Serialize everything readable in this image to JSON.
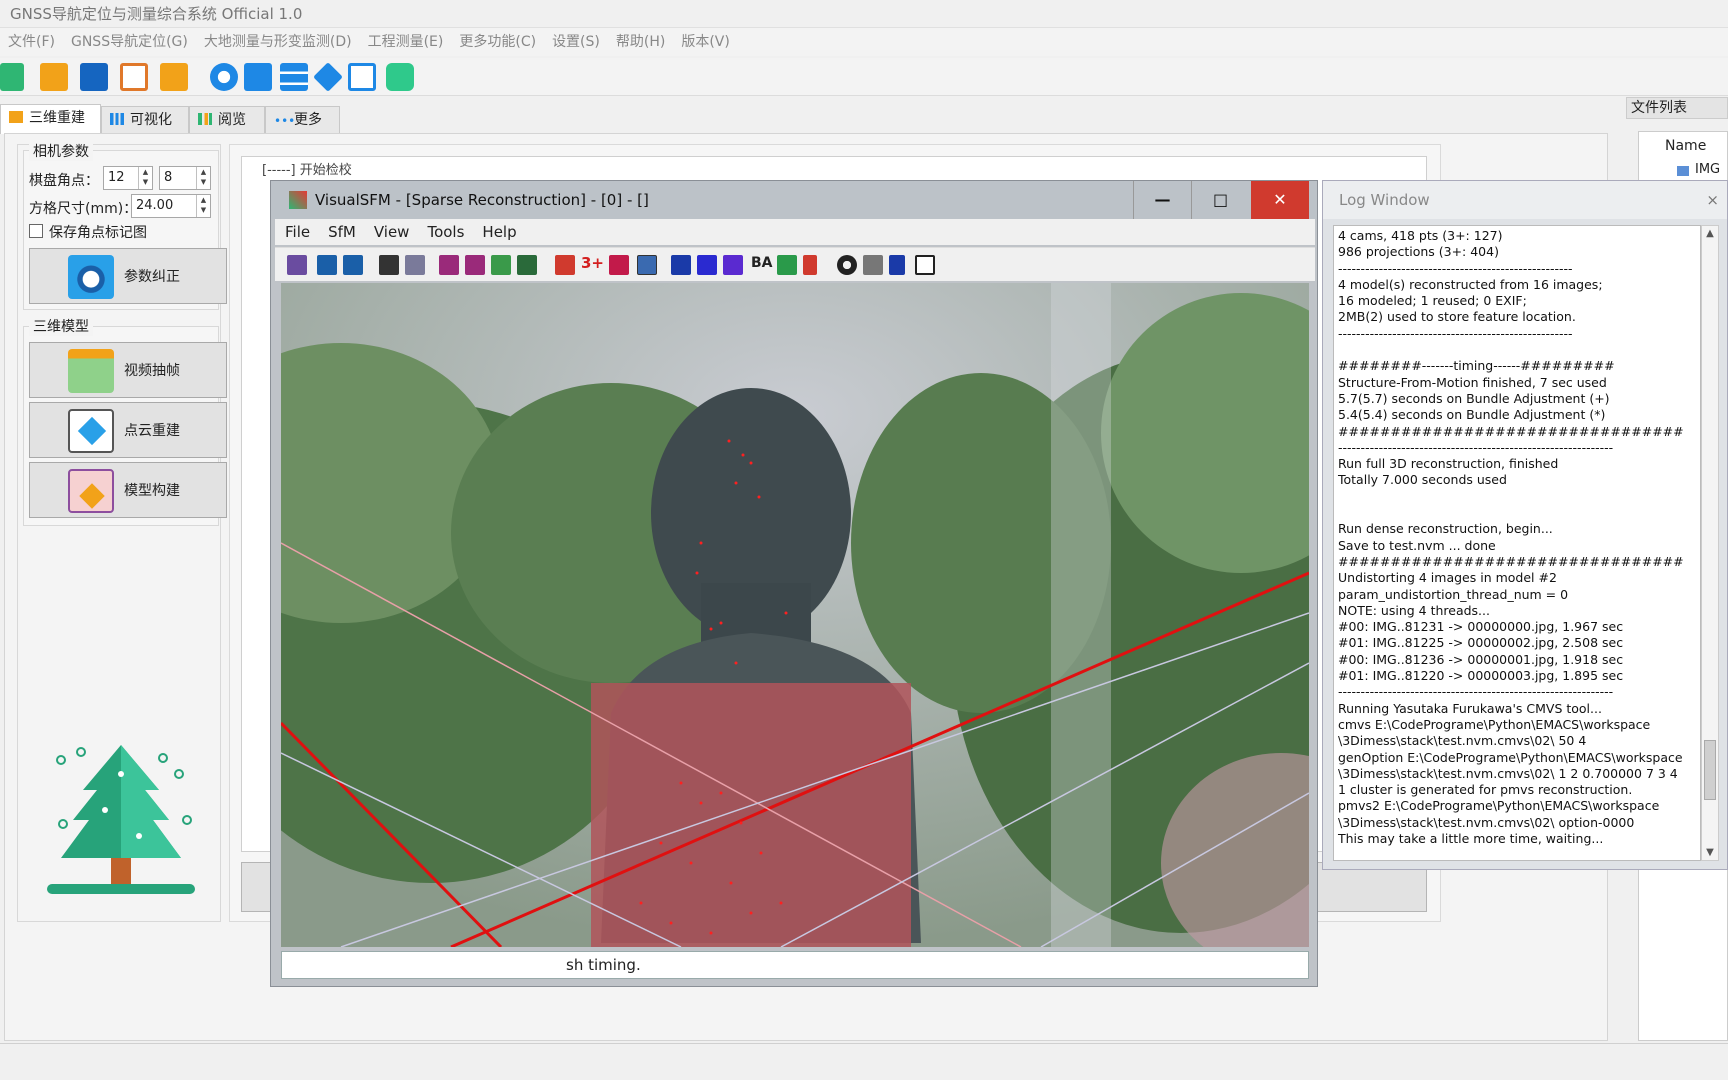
{
  "app": {
    "title": "GNSS导航定位与测量综合系统 Official 1.0"
  },
  "menu": [
    "文件(F)",
    "GNSS导航定位(G)",
    "大地测量与形变监测(D)",
    "工程测量(E)",
    "更多功能(C)",
    "设置(S)",
    "帮助(H)",
    "版本(V)"
  ],
  "toolbar_icons": [
    "new-icon",
    "folder-icon",
    "save-icon",
    "form-icon",
    "print-icon",
    "settings-icon",
    "chat-icon",
    "tree-icon",
    "layers-icon",
    "link-icon",
    "message-icon"
  ],
  "tabs": [
    {
      "label": "三维重建",
      "icon": "reconstruct-icon",
      "active": true
    },
    {
      "label": "可视化",
      "icon": "chart-icon",
      "active": false
    },
    {
      "label": "阅览",
      "icon": "view-icon",
      "active": false
    },
    {
      "label": "更多",
      "icon": "more-icon",
      "active": false
    }
  ],
  "camera": {
    "group_title": "相机参数",
    "corner_label": "棋盘角点：",
    "corner_x": "12",
    "corner_y": "8",
    "grid_label": "方格尺寸(mm)：",
    "grid_value": "24.00",
    "save_label": "保存角点标记图",
    "calib_button": "参数纠正"
  },
  "model": {
    "group_title": "三维模型",
    "btn_frames": "视频抽帧",
    "btn_cloud": "点云重建",
    "btn_build": "模型构建"
  },
  "background_log": "[-----] 开始检校",
  "filelist": {
    "title": "文件列表",
    "header": "Name",
    "item": "IMG"
  },
  "vsfm": {
    "title": "VisualSFM - [Sparse Reconstruction] - [0] - []",
    "menu": [
      "File",
      "SfM",
      "View",
      "Tools",
      "Help"
    ],
    "toolbar_texts": {
      "three_plus": "3+",
      "ba": "BA"
    },
    "status": "sh timing.",
    "min": "—",
    "max": "□",
    "close": "✕"
  },
  "logwindow": {
    "title": "Log Window",
    "close": "×",
    "lines": [
      "4 cams, 418 pts (3+: 127)",
      "986 projections (3+: 404)",
      "----------------------------------------------------",
      "4 model(s) reconstructed from 16 images;",
      "16 modeled; 1 reused; 0 EXIF;",
      "2MB(2) used to store feature location.",
      "----------------------------------------------------",
      "",
      "########-------timing------#########",
      "Structure-From-Motion finished, 7 sec used",
      "5.7(5.7) seconds on Bundle Adjustment (+)",
      "5.4(5.4) seconds on Bundle Adjustment (*)",
      "#################################",
      "-------------------------------------------------------------",
      "Run full 3D reconstruction, finished",
      "Totally 7.000 seconds used",
      "",
      "",
      "Run dense reconstruction, begin...",
      "Save to test.nvm ... done",
      "#################################",
      "Undistorting 4 images in model #2",
      "param_undistortion_thread_num = 0",
      "NOTE: using 4 threads...",
      "#00: IMG..81231 -> 00000000.jpg, 1.967 sec",
      "#01: IMG..81225 -> 00000002.jpg, 2.508 sec",
      "#00: IMG..81236 -> 00000001.jpg, 1.918 sec",
      "#01: IMG..81220 -> 00000003.jpg, 1.895 sec",
      "-------------------------------------------------------------",
      "Running Yasutaka Furukawa's CMVS tool...",
      "cmvs E:\\CodePrograme\\Python\\EMACS\\workspace",
      "\\3Dimess\\stack\\test.nvm.cmvs\\02\\ 50 4",
      "genOption E:\\CodePrograme\\Python\\EMACS\\workspace",
      "\\3Dimess\\stack\\test.nvm.cmvs\\02\\ 1 2 0.700000 7 3 4",
      "1 cluster is generated for pmvs reconstruction.",
      "pmvs2 E:\\CodePrograme\\Python\\EMACS\\workspace",
      "\\3Dimess\\stack\\test.nvm.cmvs\\02\\ option-0000",
      "This may take a little more time, waiting..."
    ]
  },
  "colors": {
    "accent_red": "#e01010",
    "close_btn": "#d03a2e",
    "tree_green": "#27a37a"
  }
}
